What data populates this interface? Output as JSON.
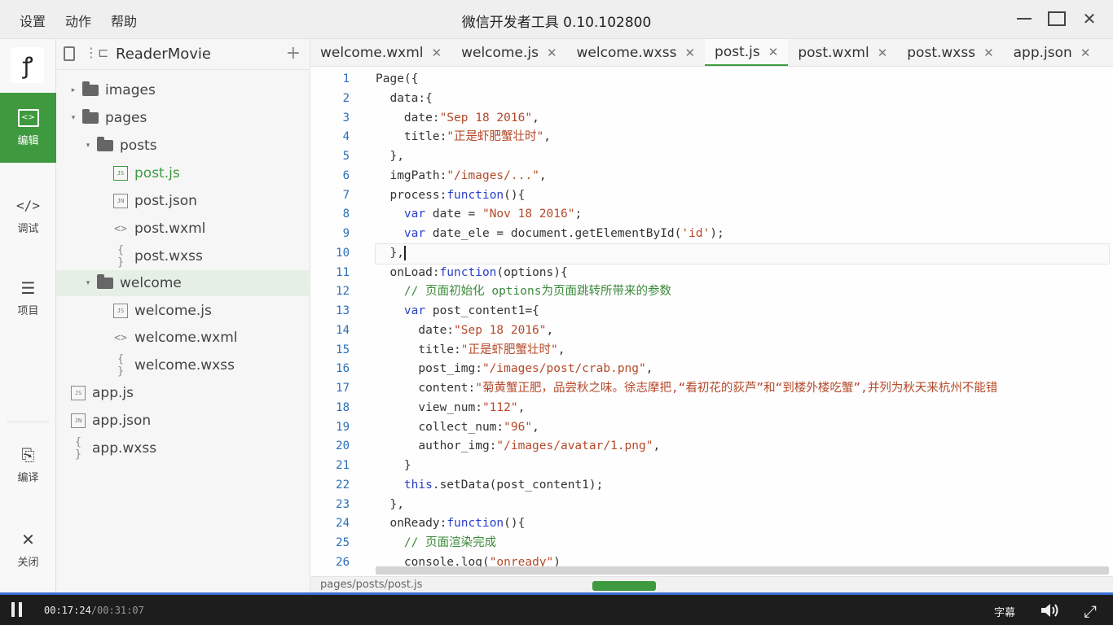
{
  "menu": [
    "设置",
    "动作",
    "帮助"
  ],
  "app_title": "微信开发者工具 0.10.102800",
  "rail": {
    "items": [
      {
        "label": "编辑",
        "icon": "edit-icon"
      },
      {
        "label": "调试",
        "icon": "code-icon"
      },
      {
        "label": "项目",
        "icon": "list-icon"
      },
      {
        "label": "编译",
        "icon": "compile-icon"
      },
      {
        "label": "关闭",
        "icon": "close-icon"
      }
    ]
  },
  "tree": {
    "project": "ReaderMovie",
    "nodes": [
      "images",
      "pages",
      "posts",
      "post.js",
      "post.json",
      "post.wxml",
      "post.wxss",
      "welcome",
      "welcome.js",
      "welcome.wxml",
      "welcome.wxss",
      "app.js",
      "app.json",
      "app.wxss"
    ]
  },
  "tabs": [
    "welcome.wxml",
    "welcome.js",
    "welcome.wxss",
    "post.js",
    "post.wxml",
    "post.wxss",
    "app.json"
  ],
  "active_tab": "post.js",
  "line_numbers": [
    "1",
    "2",
    "3",
    "4",
    "5",
    "6",
    "7",
    "8",
    "9",
    "10",
    "11",
    "12",
    "13",
    "14",
    "15",
    "16",
    "17",
    "18",
    "19",
    "20",
    "21",
    "22",
    "23",
    "24",
    "25",
    "26"
  ],
  "code": {
    "l1": "Page({",
    "l2": "  data:{",
    "l3a": "    date:",
    "l3b": "\"Sep 18 2016\"",
    "l3c": ",",
    "l4a": "    title:",
    "l4b": "\"正是虾肥蟹壮时\"",
    "l4c": ",",
    "l5": "  },",
    "l6a": "  imgPath:",
    "l6b": "\"/images/...\"",
    "l6c": ",",
    "l7a": "  process:",
    "l7b": "function",
    "l7c": "(){",
    "l8a": "    ",
    "l8b": "var",
    "l8c": " date = ",
    "l8d": "\"Nov 18 2016\"",
    "l8e": ";",
    "l9a": "    ",
    "l9b": "var",
    "l9c": " date_ele = document.getElementById(",
    "l9d": "'id'",
    "l9e": ");",
    "l10": "  },",
    "l11a": "  onLoad:",
    "l11b": "function",
    "l11c": "(options){",
    "l12": "    // 页面初始化 options为页面跳转所带来的参数",
    "l13a": "    ",
    "l13b": "var",
    "l13c": " post_content1={",
    "l14a": "      date:",
    "l14b": "\"Sep 18 2016\"",
    "l14c": ",",
    "l15a": "      title:",
    "l15b": "\"正是虾肥蟹壮时\"",
    "l15c": ",",
    "l16a": "      post_img:",
    "l16b": "\"/images/post/crab.png\"",
    "l16c": ",",
    "l17a": "      content:",
    "l17b": "\"菊黄蟹正肥，品尝秋之味。徐志摩把,“看初花的荻芦”和“到楼外楼吃蟹”,并列为秋天来杭州不能错",
    "l18a": "      view_num:",
    "l18b": "\"112\"",
    "l18c": ",",
    "l19a": "      collect_num:",
    "l19b": "\"96\"",
    "l19c": ",",
    "l20a": "      author_img:",
    "l20b": "\"/images/avatar/1.png\"",
    "l20c": ",",
    "l21": "    }",
    "l22a": "    ",
    "l22b": "this",
    "l22c": ".setData(post_content1);",
    "l23": "  },",
    "l24a": "  onReady:",
    "l24b": "function",
    "l24c": "(){",
    "l25": "    // 页面渲染完成",
    "l26a": "    console.log(",
    "l26b": "\"onready\"",
    "l26c": ")"
  },
  "status": {
    "path": "pages/posts/post.js"
  },
  "player": {
    "current": "00:17:24",
    "total": "/00:31:07",
    "subtitle": "字幕"
  },
  "colors": {
    "accent": "#3f9a3f",
    "keyword": "#2a40c8",
    "string": "#b44a2a",
    "comment": "#3b8a3b"
  }
}
